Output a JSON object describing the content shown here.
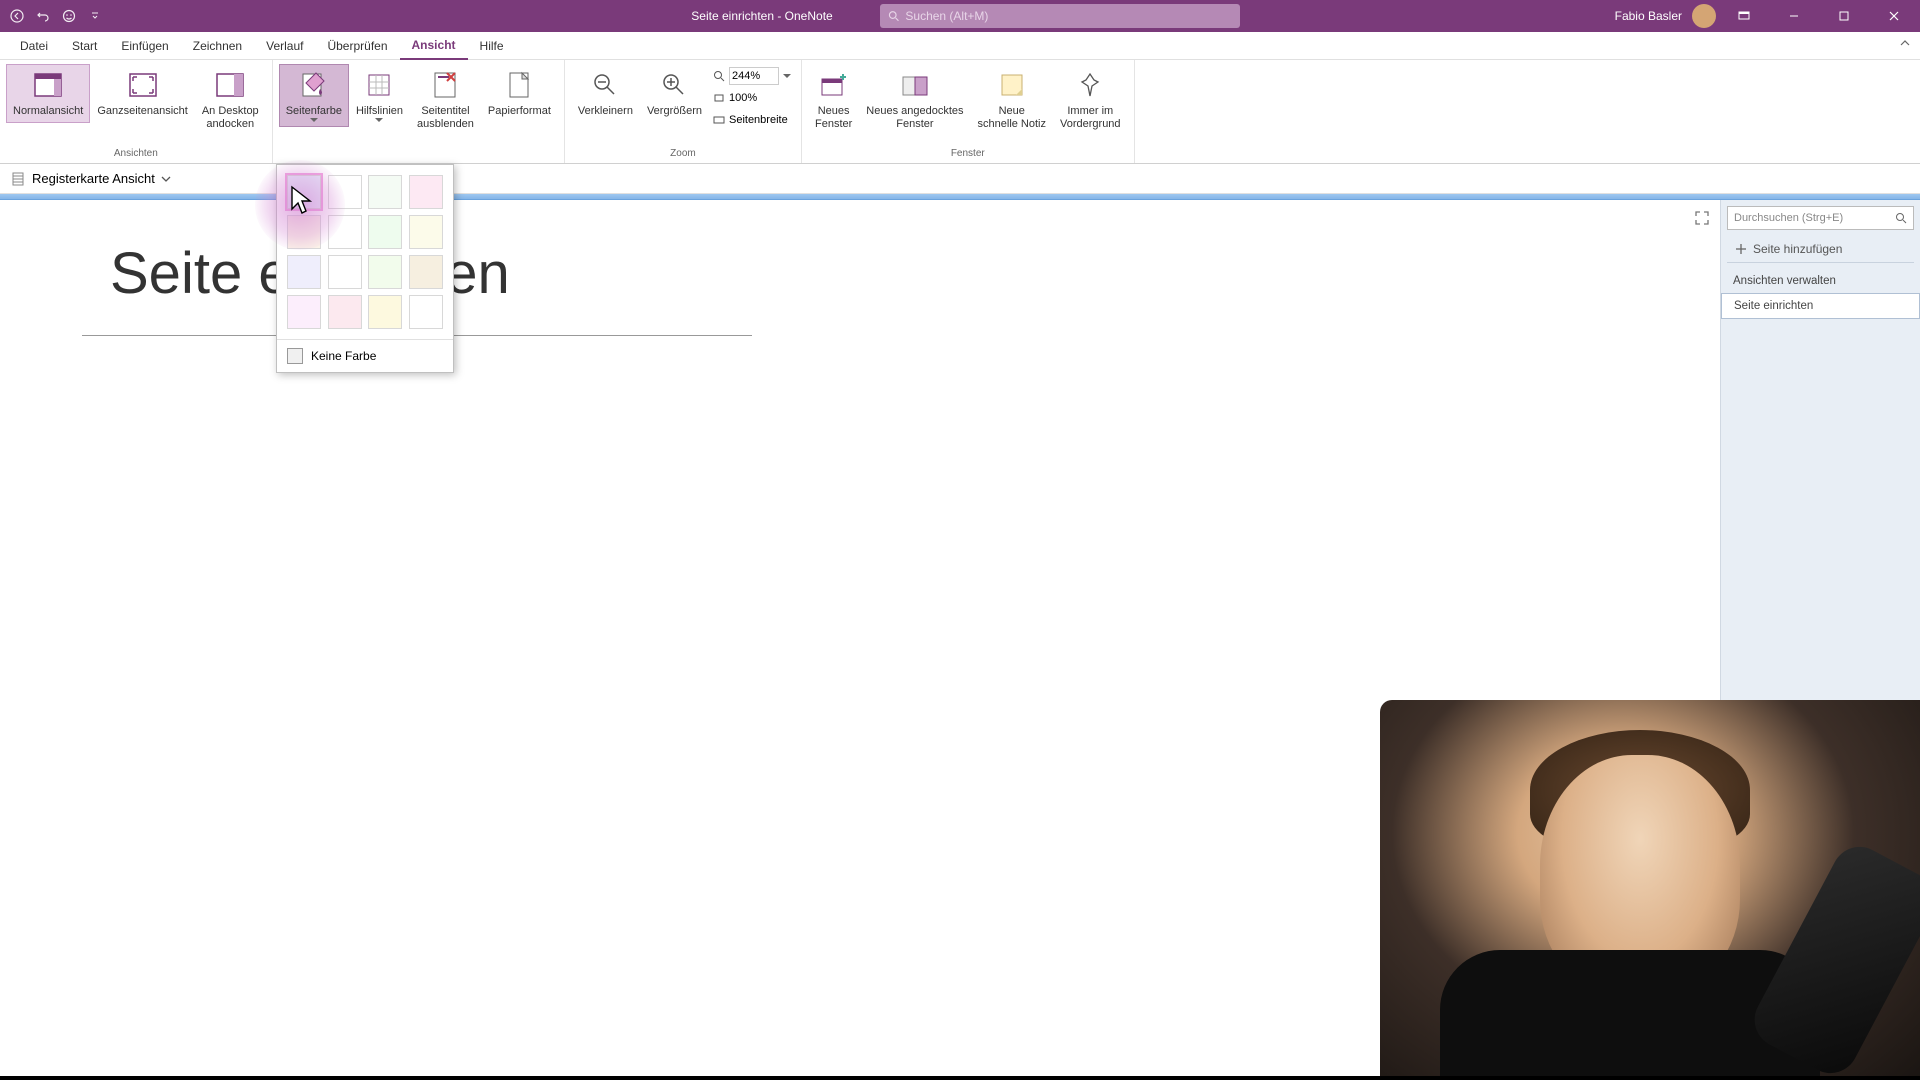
{
  "titlebar": {
    "title": "Seite einrichten  -  OneNote",
    "search_placeholder": "Suchen (Alt+M)",
    "user_name": "Fabio Basler"
  },
  "menubar": {
    "tabs": [
      "Datei",
      "Start",
      "Einfügen",
      "Zeichnen",
      "Verlauf",
      "Überprüfen",
      "Ansicht",
      "Hilfe"
    ],
    "active_index": 6
  },
  "ribbon": {
    "views_group_label": "Ansichten",
    "zoom_group_label": "Zoom",
    "window_group_label": "Fenster",
    "btn_normal": "Normalansicht",
    "btn_fullpage": "Ganzseitenansicht",
    "btn_dock": "An Desktop\nandocken",
    "btn_pagecolor": "Seitenfarbe",
    "btn_gridlines": "Hilfslinien",
    "btn_hidetitle": "Seitentitel\nausblenden",
    "btn_paperformat": "Papierformat",
    "btn_zoomout": "Verkleinern",
    "btn_zoomin": "Vergrößern",
    "zoom_value": "244%",
    "zoom_100": "100%",
    "zoom_pagewidth": "Seitenbreite",
    "btn_newwindow": "Neues\nFenster",
    "btn_newdocked": "Neues angedocktes\nFenster",
    "btn_quicknote": "Neue\nschnelle Notiz",
    "btn_alwaystop": "Immer im\nVordergrund"
  },
  "notebook_bar": {
    "label": "Registerkarte Ansicht"
  },
  "color_popup": {
    "no_color": "Keine Farbe",
    "colors_row1": [
      "#e8f0fc",
      "#ffffff",
      "#f4fbf4",
      "#fde9f3"
    ],
    "colors_row2": [
      "#fbf2e8",
      "#ffffff",
      "#eefcee",
      "#fcfbea"
    ],
    "colors_row3": [
      "#efeefc",
      "#ffffff",
      "#f2fcec",
      "#f6efe0"
    ],
    "colors_row4": [
      "#fceefc",
      "#fce9ef",
      "#fdf9df",
      "#ffffff"
    ]
  },
  "canvas": {
    "page_title": "Seite einrichten"
  },
  "side_panel": {
    "search_placeholder": "Durchsuchen (Strg+E)",
    "add_page": "Seite hinzufügen",
    "pages": [
      "Ansichten verwalten",
      "Seite einrichten"
    ],
    "selected_index": 1
  }
}
